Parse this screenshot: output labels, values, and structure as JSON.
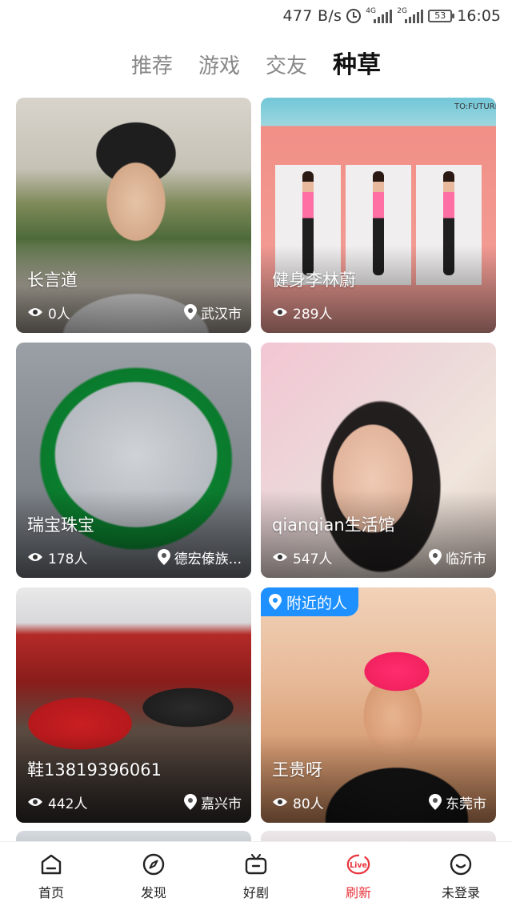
{
  "status_bar": {
    "speed": "477 B/s",
    "signal1_tag": "4G",
    "signal2_tag": "2G",
    "battery": "53",
    "time": "16:05"
  },
  "tabs": [
    {
      "label": "推荐",
      "active": false
    },
    {
      "label": "游戏",
      "active": false
    },
    {
      "label": "交友",
      "active": false
    },
    {
      "label": "种草",
      "active": true
    }
  ],
  "cards": [
    {
      "name": "长言道",
      "viewers": "0人",
      "location": "武汉市"
    },
    {
      "name": "健身李林蔚",
      "viewers": "289人",
      "location": ""
    },
    {
      "name": "瑞宝珠宝",
      "viewers": "178人",
      "location": "德宏傣族..."
    },
    {
      "name": "qianqian生活馆",
      "viewers": "547人",
      "location": "临沂市"
    },
    {
      "name": "鞋13819396061",
      "viewers": "442人",
      "location": "嘉兴市"
    },
    {
      "name": "王贵呀",
      "viewers": "80人",
      "location": "东莞市",
      "badge": "附近的人"
    }
  ],
  "image_text": {
    "fitness_brand": "TO:FUTURE"
  },
  "bottom_nav": [
    {
      "label": "首页",
      "icon": "home-icon",
      "active": false
    },
    {
      "label": "发现",
      "icon": "compass-icon",
      "active": false
    },
    {
      "label": "好剧",
      "icon": "tv-icon",
      "active": false
    },
    {
      "label": "刷新",
      "icon": "live-refresh-icon",
      "active": true
    },
    {
      "label": "未登录",
      "icon": "smiley-icon",
      "active": false
    }
  ],
  "colors": {
    "accent_red": "#e8353d",
    "badge_blue": "#1e90ff"
  }
}
